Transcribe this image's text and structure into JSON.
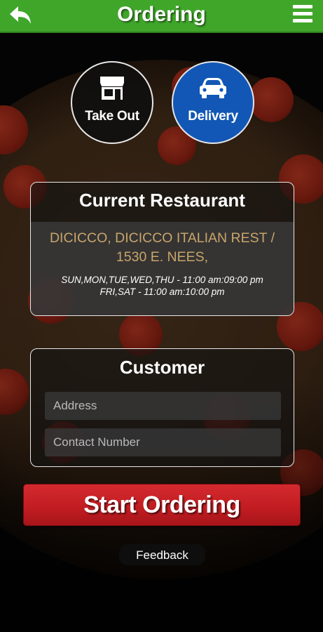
{
  "header": {
    "title": "Ordering",
    "back_icon": "back-arrow-icon",
    "menu_icon": "hamburger-menu-icon",
    "color": "#40a62a"
  },
  "order_types": [
    {
      "label": "Take Out",
      "icon": "storefront-icon",
      "selected": false
    },
    {
      "label": "Delivery",
      "icon": "car-icon",
      "selected": true,
      "color": "#1257b5"
    }
  ],
  "restaurant": {
    "title": "Current Restaurant",
    "name": "DICICCO, DICICCO ITALIAN REST / 1530 E. NEES,",
    "hours_1": "SUN,MON,TUE,WED,THU - 11:00 am:09:00 pm",
    "hours_2": "FRI,SAT - 11:00 am:10:00 pm",
    "name_color": "#c9a56a"
  },
  "customer": {
    "title": "Customer",
    "address_placeholder": "Address",
    "contact_placeholder": "Contact Number"
  },
  "actions": {
    "start_label": "Start Ordering",
    "start_color": "#c21d22",
    "feedback_label": "Feedback"
  }
}
